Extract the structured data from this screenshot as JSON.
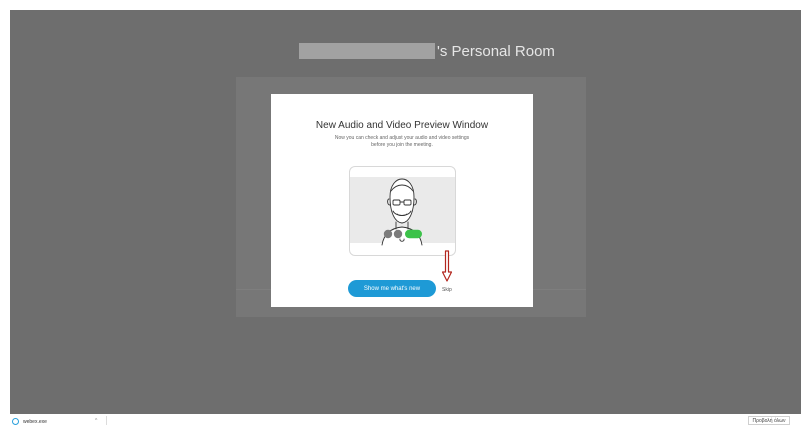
{
  "room": {
    "owner_name": "",
    "title_suffix": "'s Personal Room"
  },
  "dialog": {
    "title": "New Audio and Video Preview Window",
    "description_line1": "Now you can check and adjust your audio and video settings",
    "description_line2": "before you join the meeting.",
    "primary_button": "Show me what's new",
    "skip_link": "Skip"
  },
  "illustration": {
    "icons": [
      "person-avatar-icon",
      "mute-button-icon",
      "video-button-icon",
      "join-button-icon"
    ]
  },
  "annotation": {
    "arrow": "red-arrow-icon"
  },
  "downloads_bar": {
    "file_name": "webex.exe",
    "show_all_label": "Προβολή όλων"
  },
  "colors": {
    "backdrop": "#6e6e6e",
    "primary_button": "#1e9ad6",
    "join_green": "#3cc24a",
    "arrow_red": "#b3261e"
  }
}
